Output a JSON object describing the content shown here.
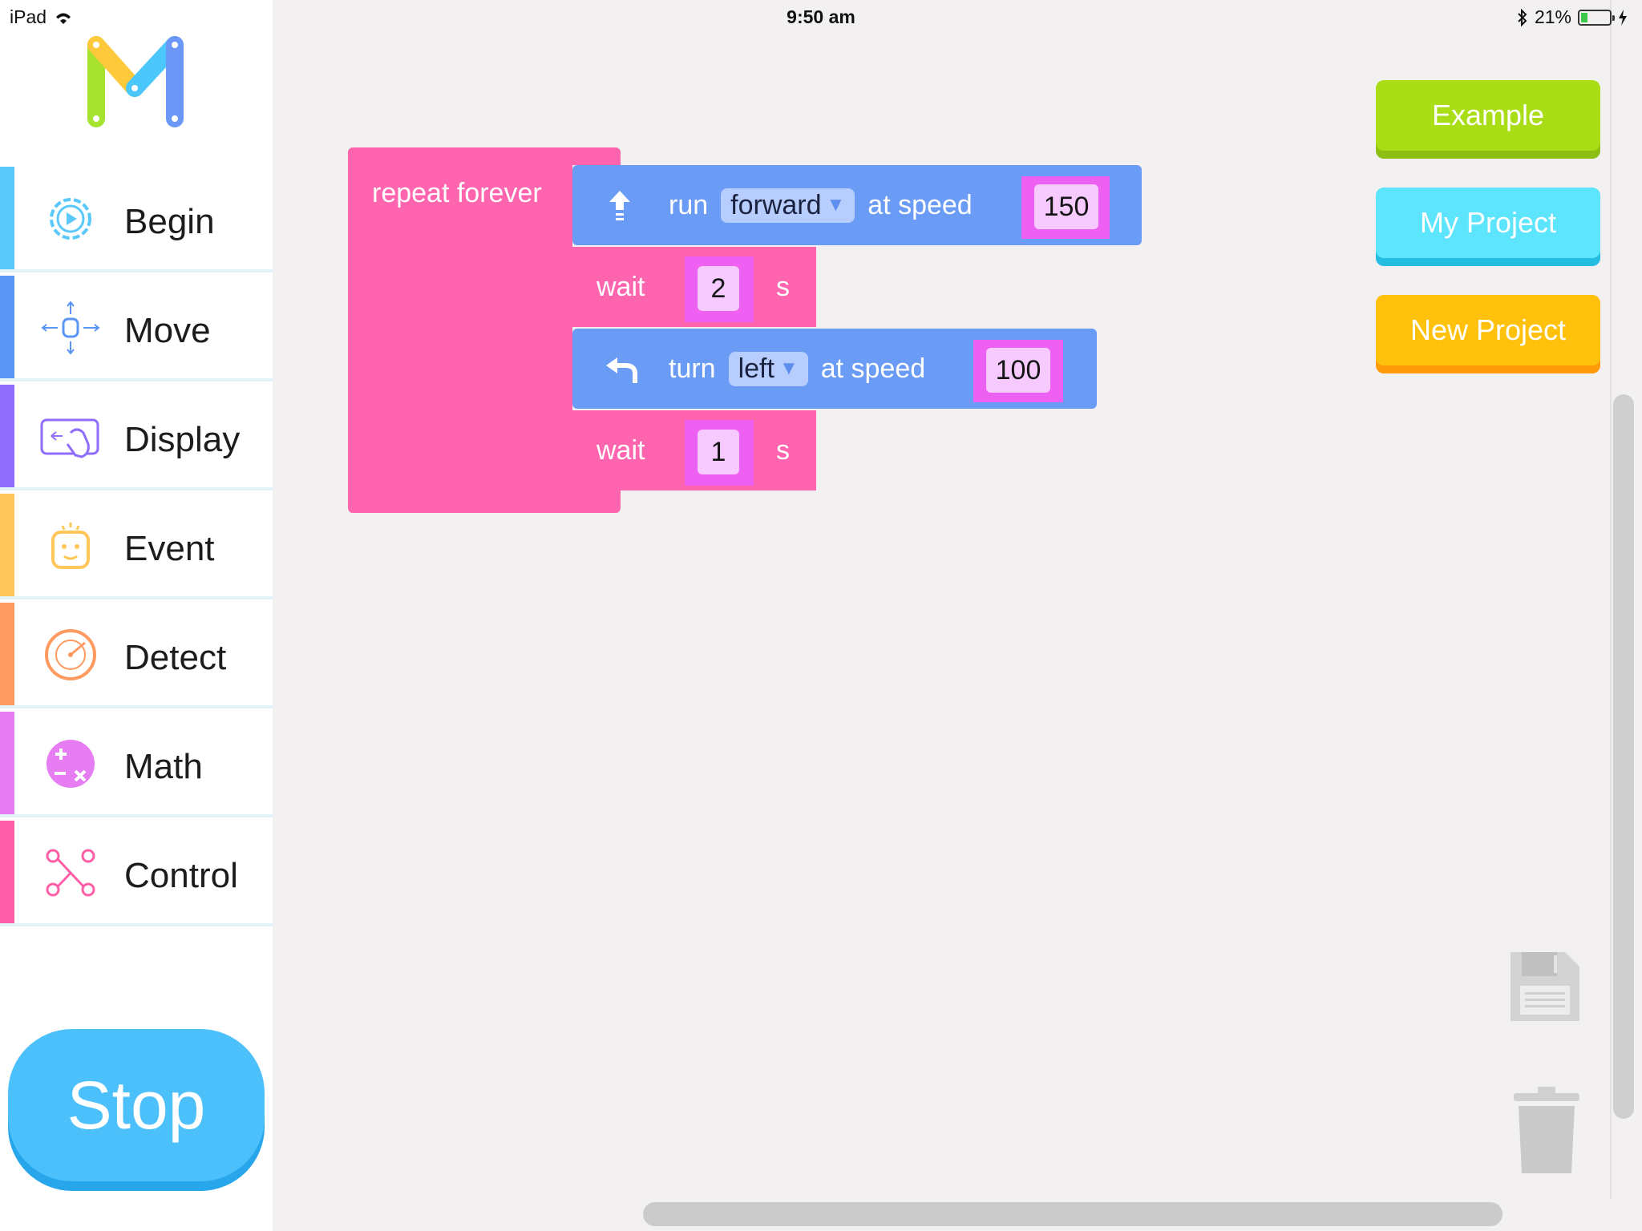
{
  "status_bar": {
    "device": "iPad",
    "time": "9:50 am",
    "battery": "21%"
  },
  "sidebar": {
    "categories": [
      {
        "label": "Begin",
        "icon": "gear-play-icon",
        "color": "#5bc8fb"
      },
      {
        "label": "Move",
        "icon": "robot-move-icon",
        "color": "#5b95f5"
      },
      {
        "label": "Display",
        "icon": "touch-screen-icon",
        "color": "#8f6dfb"
      },
      {
        "label": "Event",
        "icon": "robot-face-icon",
        "color": "#ffc75a"
      },
      {
        "label": "Detect",
        "icon": "radar-icon",
        "color": "#ff9a61"
      },
      {
        "label": "Math",
        "icon": "math-operators-icon",
        "color": "#e67df2"
      },
      {
        "label": "Control",
        "icon": "branch-nodes-icon",
        "color": "#ff5ea6"
      }
    ],
    "stop_label": "Stop"
  },
  "program": {
    "repeat_label": "repeat forever",
    "run": {
      "label": "run",
      "direction": "forward",
      "at_speed": "at speed",
      "speed": "150"
    },
    "wait1": {
      "label": "wait",
      "value": "2",
      "unit": "s"
    },
    "turn": {
      "label": "turn",
      "direction": "left",
      "at_speed": "at speed",
      "speed": "100"
    },
    "wait2": {
      "label": "wait",
      "value": "1",
      "unit": "s"
    }
  },
  "actions": {
    "example": "Example",
    "my_project": "My Project",
    "new_project": "New Project"
  },
  "colors": {
    "pink_block": "#ff65ae",
    "blue_block": "#6a9cf5",
    "slot": "#ee60f2",
    "stop": "#4cc0fb"
  }
}
